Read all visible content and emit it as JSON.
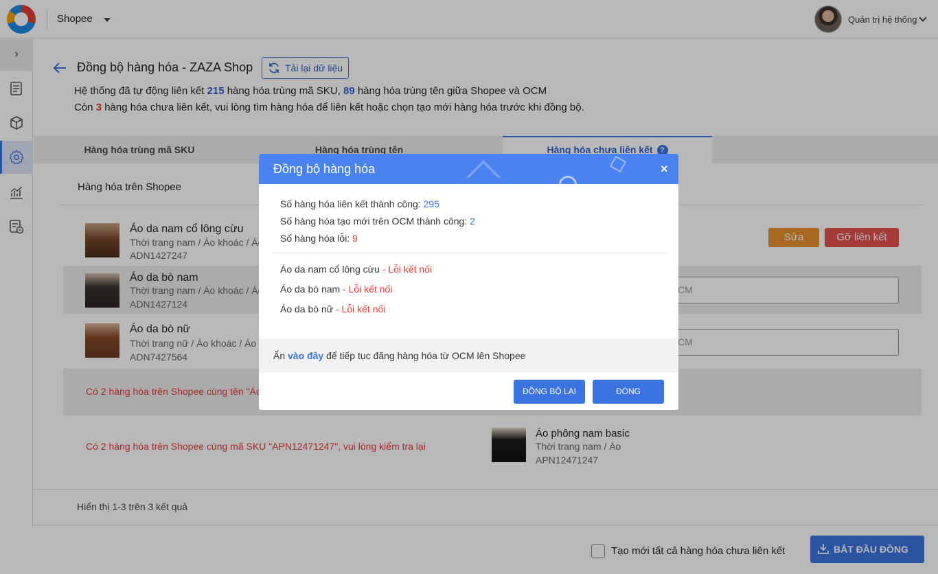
{
  "topbar": {
    "store": "Shopee",
    "admin": "Quản trị hệ thống"
  },
  "sidebar": {
    "toggle": "›"
  },
  "page": {
    "title": "Đồng bộ hàng hóa - ZAZA Shop",
    "reload_label": "Tải lại dữ liệu",
    "info1_a": "Hệ thống đã tự động liên kết ",
    "info1_n1": "215",
    "info1_b": " hàng hóa trùng mã SKU, ",
    "info1_n2": "89",
    "info1_c": " hàng hóa trùng tên giữa Shopee và OCM",
    "info2_a": "Còn ",
    "info2_n": "3",
    "info2_b": " hàng hóa chưa liên kết, vui lòng tìm hàng hóa để liên kết hoặc chọn tạo mới hàng hóa trước khi đồng bộ."
  },
  "tabs": [
    {
      "label": "Hàng hóa trùng mã SKU"
    },
    {
      "label": "Hàng hóa trùng tên"
    },
    {
      "label": "Hàng hóa chưa liên kết"
    }
  ],
  "tab_help": "?",
  "section": {
    "heading": "Hàng hóa trên Shopee"
  },
  "products": [
    {
      "name": "Áo da nam cổ lông cừu",
      "category": "Thời trang nam / Áo khoác / Áo",
      "sku": "ADN1427247"
    },
    {
      "name": "Áo da bò nam",
      "category": "Thời trang nam / Áo khoác / Áo",
      "sku": "ADN1427124"
    },
    {
      "name": "Áo da bò nữ",
      "category": "Thời trang nữ / Áo khoác / Áo",
      "sku": "ADN7427564"
    }
  ],
  "row_actions": {
    "edit": "Sửa",
    "unlink": "Gỡ liên kết"
  },
  "search_placeholder": "CM",
  "error_rows": [
    "Có 2 hàng hóa trên Shopee cùng tên \"Áo",
    "Có 2 hàng hóa trên Shopee cùng mã SKU \"APN12471247\", vui lòng kiểm tra lại"
  ],
  "ocm_product": {
    "name": "Áo phông nam basic",
    "category": "Thời trang nam / Áo",
    "sku": "APN12471247"
  },
  "footer": {
    "count": "Hiển thị 1-3 trên 3 kết quả"
  },
  "bottom": {
    "checkbox_label": "Tạo mới tất cả hàng hóa chưa liên kết",
    "start_label": "BẮT ĐẦU ĐỒNG BỘ"
  },
  "modal": {
    "title": "Đồng bộ hàng hóa",
    "close": "×",
    "stat1_label": "Số hàng hóa liên kết thành công: ",
    "stat1_value": "295",
    "stat2_label": "Số hàng hóa tạo mới trên OCM thành công: ",
    "stat2_value": "2",
    "stat3_label": "Số hàng hóa lỗi: ",
    "stat3_value": "9",
    "errors": [
      {
        "name": "Áo da nam cổ lông cừu",
        "err": " - Lỗi kết nối"
      },
      {
        "name": "Áo da bò nam",
        "err": " - Lỗi kết nối"
      },
      {
        "name": "Áo da bò nữ",
        "err": " - Lỗi kết nối"
      }
    ],
    "note_a": "Ấn ",
    "note_link": "vào đây",
    "note_b": " để tiếp tục đăng hàng hóa từ OCM lên Shopee",
    "resync": "ĐỒNG BỘ LẠI",
    "close_btn": "ĐÓNG"
  },
  "colors": {
    "primary": "#3b73e0",
    "modal_header": "#4a82ef",
    "error": "#e53935",
    "edit": "#e8912f",
    "unlink": "#e5534f"
  }
}
